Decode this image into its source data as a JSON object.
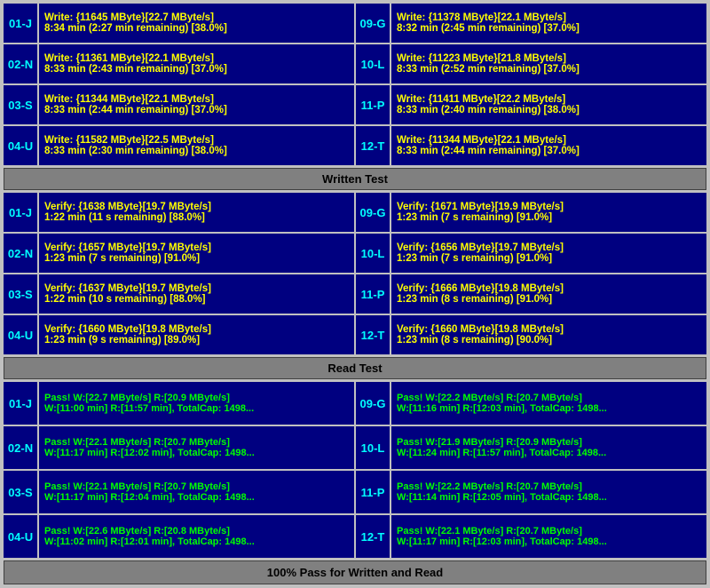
{
  "sections": {
    "write_test_label": "Written Test",
    "read_test_label": "Read Test",
    "bottom_banner": "100% Pass for Written and Read"
  },
  "write_rows": [
    {
      "left": {
        "id": "01-J",
        "line1": "Write: {11645 MByte}[22.7 MByte/s]",
        "line2": "8:34 min (2:27 min remaining)  [38.0%]"
      },
      "right": {
        "id": "09-G",
        "line1": "Write: {11378 MByte}[22.1 MByte/s]",
        "line2": "8:32 min (2:45 min remaining)  [37.0%]"
      }
    },
    {
      "left": {
        "id": "02-N",
        "line1": "Write: {11361 MByte}[22.1 MByte/s]",
        "line2": "8:33 min (2:43 min remaining)  [37.0%]"
      },
      "right": {
        "id": "10-L",
        "line1": "Write: {11223 MByte}[21.8 MByte/s]",
        "line2": "8:33 min (2:52 min remaining)  [37.0%]"
      }
    },
    {
      "left": {
        "id": "03-S",
        "line1": "Write: {11344 MByte}[22.1 MByte/s]",
        "line2": "8:33 min (2:44 min remaining)  [37.0%]"
      },
      "right": {
        "id": "11-P",
        "line1": "Write: {11411 MByte}[22.2 MByte/s]",
        "line2": "8:33 min (2:40 min remaining)  [38.0%]"
      }
    },
    {
      "left": {
        "id": "04-U",
        "line1": "Write: {11582 MByte}[22.5 MByte/s]",
        "line2": "8:33 min (2:30 min remaining)  [38.0%]"
      },
      "right": {
        "id": "12-T",
        "line1": "Write: {11344 MByte}[22.1 MByte/s]",
        "line2": "8:33 min (2:44 min remaining)  [37.0%]"
      }
    }
  ],
  "verify_rows": [
    {
      "left": {
        "id": "01-J",
        "line1": "Verify: {1638 MByte}[19.7 MByte/s]",
        "line2": "1:22 min (11 s remaining)   [88.0%]"
      },
      "right": {
        "id": "09-G",
        "line1": "Verify: {1671 MByte}[19.9 MByte/s]",
        "line2": "1:23 min (7 s remaining)   [91.0%]"
      }
    },
    {
      "left": {
        "id": "02-N",
        "line1": "Verify: {1657 MByte}[19.7 MByte/s]",
        "line2": "1:23 min (7 s remaining)   [91.0%]"
      },
      "right": {
        "id": "10-L",
        "line1": "Verify: {1656 MByte}[19.7 MByte/s]",
        "line2": "1:23 min (7 s remaining)   [91.0%]"
      }
    },
    {
      "left": {
        "id": "03-S",
        "line1": "Verify: {1637 MByte}[19.7 MByte/s]",
        "line2": "1:22 min (10 s remaining)   [88.0%]"
      },
      "right": {
        "id": "11-P",
        "line1": "Verify: {1666 MByte}[19.8 MByte/s]",
        "line2": "1:23 min (8 s remaining)   [91.0%]"
      }
    },
    {
      "left": {
        "id": "04-U",
        "line1": "Verify: {1660 MByte}[19.8 MByte/s]",
        "line2": "1:23 min (9 s remaining)   [89.0%]"
      },
      "right": {
        "id": "12-T",
        "line1": "Verify: {1660 MByte}[19.8 MByte/s]",
        "line2": "1:23 min (8 s remaining)   [90.0%]"
      }
    }
  ],
  "read_rows": [
    {
      "left": {
        "id": "01-J",
        "line1": "Pass! W:[22.7 MByte/s] R:[20.9 MByte/s]",
        "line2": "W:[11:00 min] R:[11:57 min], TotalCap: 1498..."
      },
      "right": {
        "id": "09-G",
        "line1": "Pass! W:[22.2 MByte/s] R:[20.7 MByte/s]",
        "line2": "W:[11:16 min] R:[12:03 min], TotalCap: 1498..."
      }
    },
    {
      "left": {
        "id": "02-N",
        "line1": "Pass! W:[22.1 MByte/s] R:[20.7 MByte/s]",
        "line2": "W:[11:17 min] R:[12:02 min], TotalCap: 1498..."
      },
      "right": {
        "id": "10-L",
        "line1": "Pass! W:[21.9 MByte/s] R:[20.9 MByte/s]",
        "line2": "W:[11:24 min] R:[11:57 min], TotalCap: 1498..."
      }
    },
    {
      "left": {
        "id": "03-S",
        "line1": "Pass! W:[22.1 MByte/s] R:[20.7 MByte/s]",
        "line2": "W:[11:17 min] R:[12:04 min], TotalCap: 1498..."
      },
      "right": {
        "id": "11-P",
        "line1": "Pass! W:[22.2 MByte/s] R:[20.7 MByte/s]",
        "line2": "W:[11:14 min] R:[12:05 min], TotalCap: 1498..."
      }
    },
    {
      "left": {
        "id": "04-U",
        "line1": "Pass! W:[22.6 MByte/s] R:[20.8 MByte/s]",
        "line2": "W:[11:02 min] R:[12:01 min], TotalCap: 1498..."
      },
      "right": {
        "id": "12-T",
        "line1": "Pass! W:[22.1 MByte/s] R:[20.7 MByte/s]",
        "line2": "W:[11:17 min] R:[12:03 min], TotalCap: 1498..."
      }
    }
  ]
}
